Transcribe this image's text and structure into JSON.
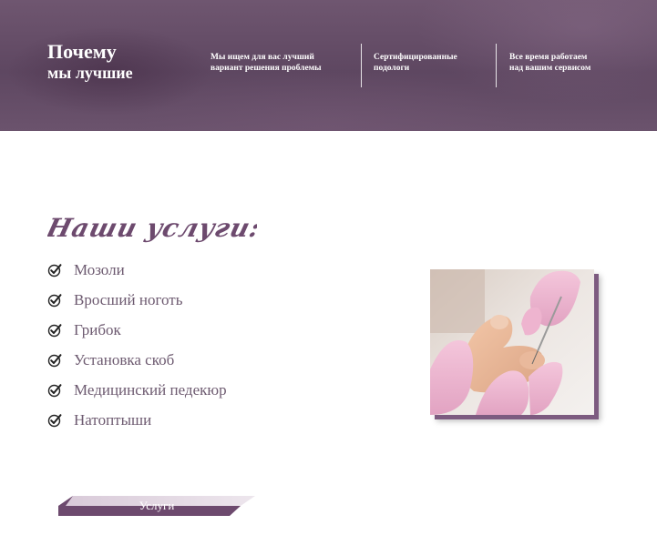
{
  "hero": {
    "title_line1": "Почему",
    "title_line2": "мы лучшие",
    "features": [
      {
        "line1": "Мы ищем для вас лучший",
        "line2": "вариант решения проблемы"
      },
      {
        "line1": "Сертифицированные",
        "line2": "подологи"
      },
      {
        "line1": "Все время работаем",
        "line2": "над вашим сервисом"
      }
    ]
  },
  "services": {
    "heading": "Наши услуги:",
    "items": [
      {
        "label": "Мозоли",
        "icon": "check-icon"
      },
      {
        "label": "Вросший ноготь",
        "icon": "check-icon"
      },
      {
        "label": "Грибок",
        "icon": "check-icon"
      },
      {
        "label": "Установка скоб",
        "icon": "check-icon"
      },
      {
        "label": "Медицинский педекюр",
        "icon": "check-icon"
      },
      {
        "label": "Натоптыши",
        "icon": "check-icon"
      }
    ],
    "button_label": "Услуги"
  },
  "colors": {
    "brand_purple": "#6d4a6e",
    "hero_bg": "#5e4761",
    "text_muted": "#6d5a70"
  }
}
